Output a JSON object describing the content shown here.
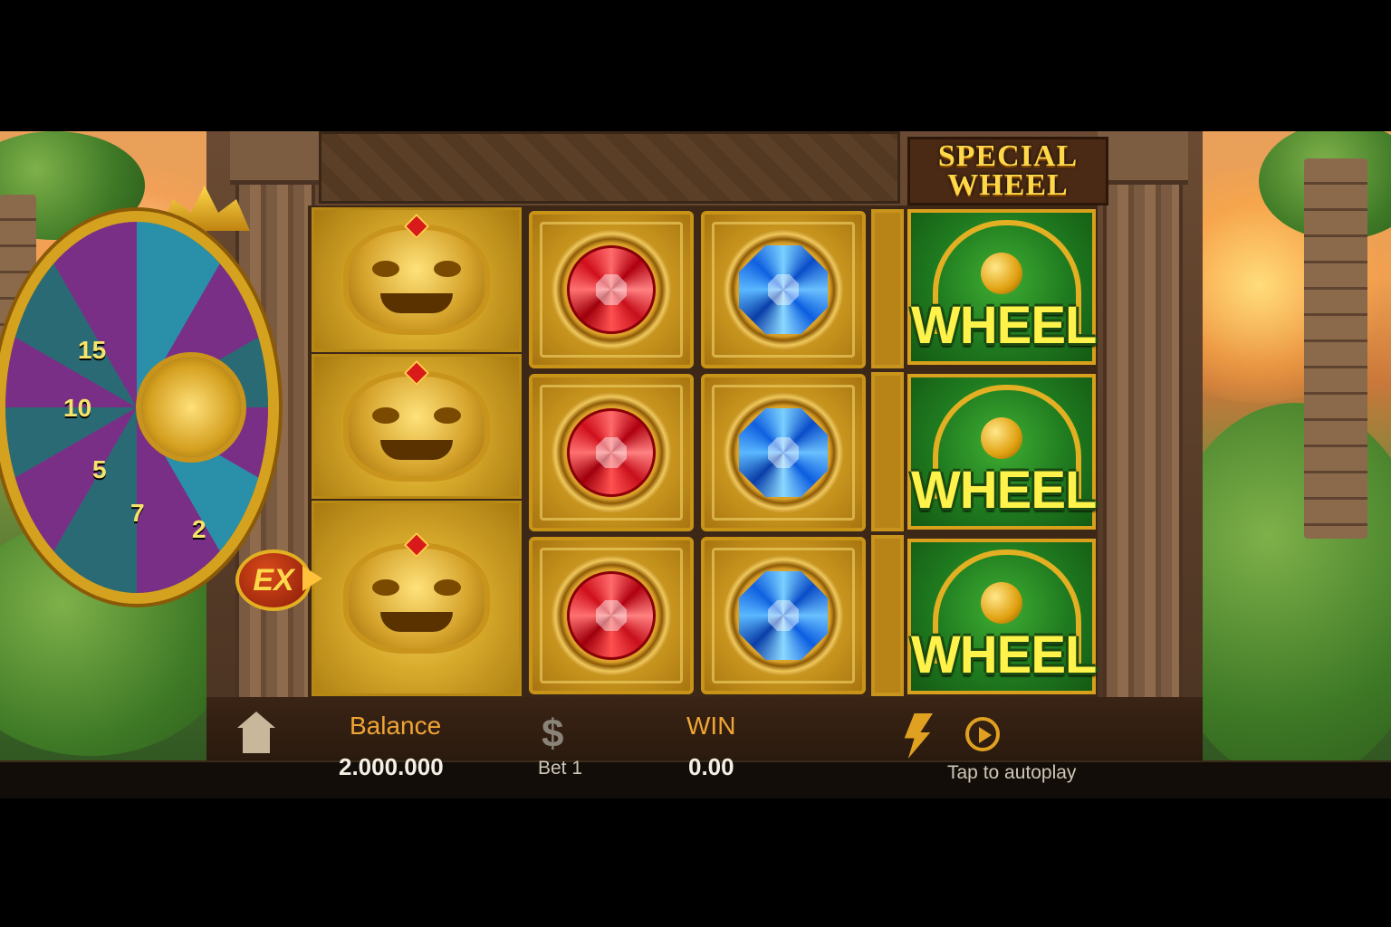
{
  "game": {
    "special_wheel_line1": "SPECIAL",
    "special_wheel_line2": "WHEEL",
    "ex_badge": "EX",
    "wheel_label": "WHEEL"
  },
  "wheel": {
    "numbers": [
      "15",
      "10",
      "5",
      "7",
      "2"
    ]
  },
  "reels": {
    "reel1": [
      "guardian-mask",
      "guardian-mask",
      "guardian-mask"
    ],
    "reel2": [
      "ruby",
      "ruby",
      "ruby"
    ],
    "reel3": [
      "sapphire",
      "sapphire",
      "sapphire"
    ],
    "reel4": [
      "wheel",
      "wheel",
      "wheel"
    ]
  },
  "hud": {
    "balance_label": "Balance",
    "balance_value": "2.000.000",
    "bet_label": "Bet 1",
    "win_label": "WIN",
    "win_value": "0.00",
    "autoplay_label": "Tap to autoplay"
  },
  "icons": [
    "home-icon",
    "dollar-icon",
    "lightning-icon",
    "autoplay-icon"
  ],
  "colors": {
    "gold": "#d4a21e",
    "hud_label": "#f0a534",
    "wheel_text": "#fff24a"
  }
}
